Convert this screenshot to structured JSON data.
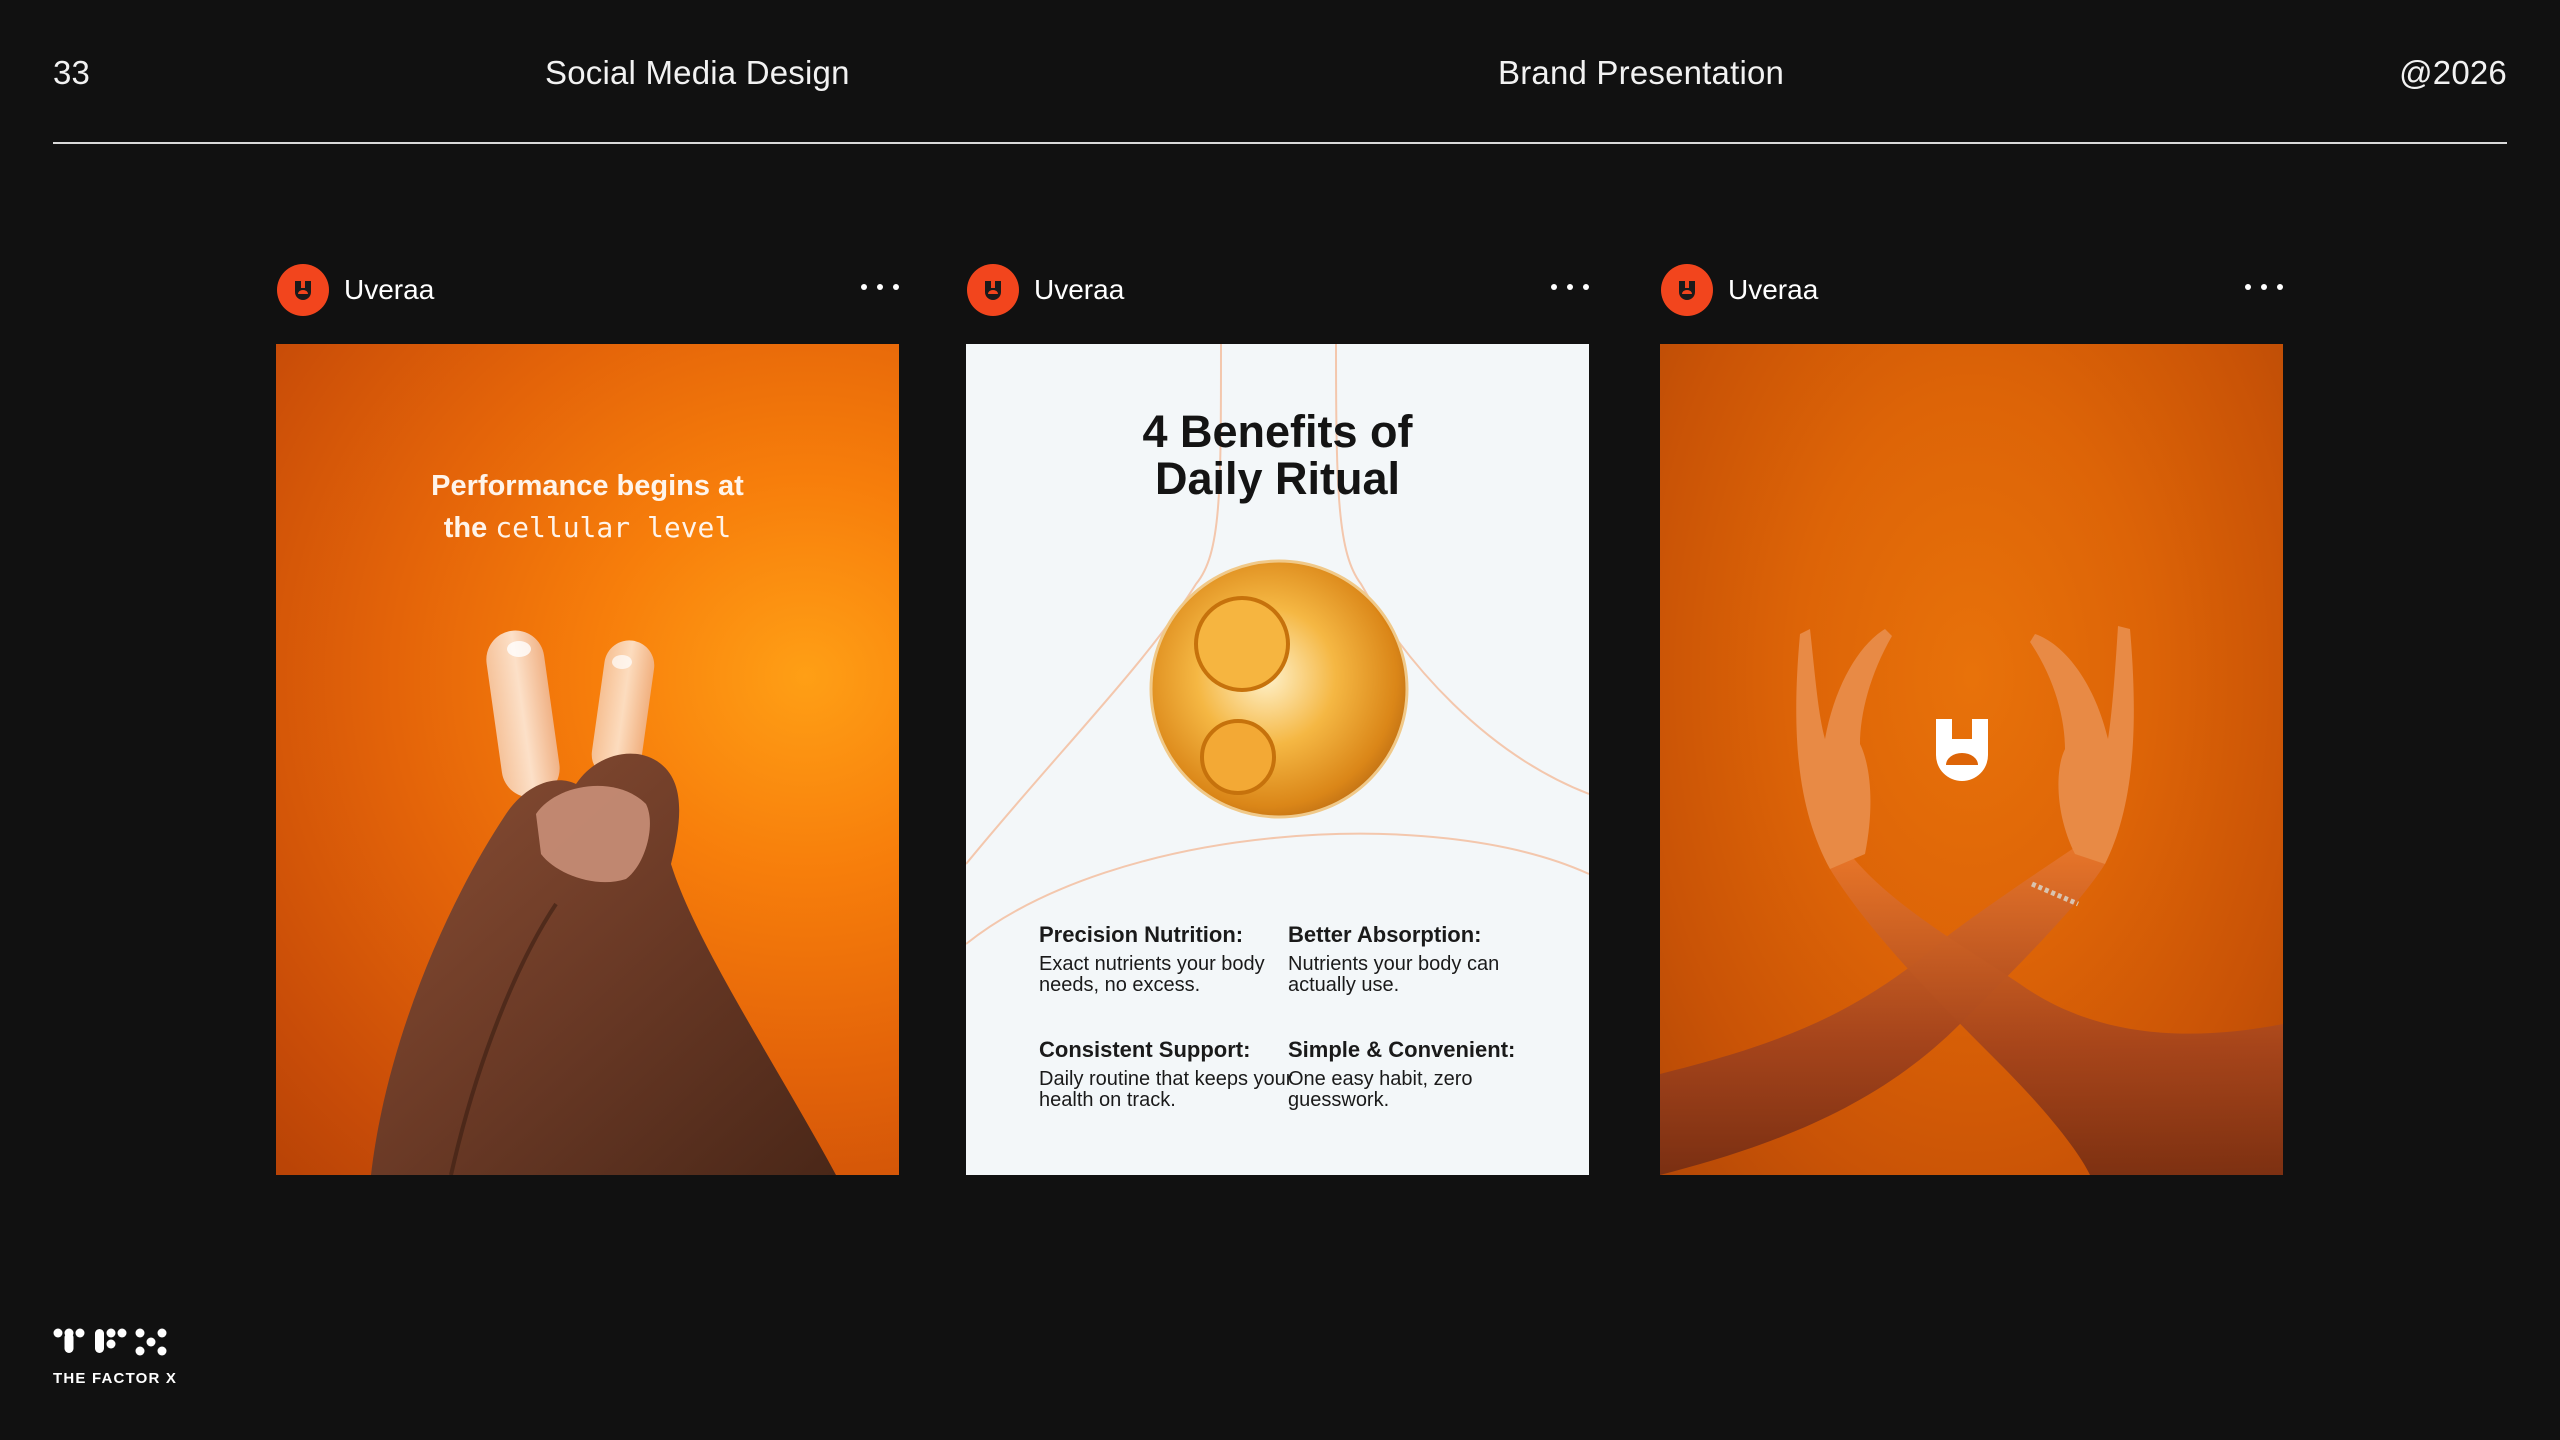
{
  "header": {
    "page_number": "33",
    "left_title": "Social Media Design",
    "center_title": "Brand Presentation",
    "right_label": "@2026"
  },
  "posts": [
    {
      "username": "Uveraa",
      "image": {
        "headline_line1": "Performance begins at",
        "headline_word": "the",
        "headline_mono": "cellular level"
      }
    },
    {
      "username": "Uveraa",
      "image": {
        "title_line1": "4 Benefits of",
        "title_line2": "Daily Ritual",
        "benefits": [
          {
            "title": "Precision Nutrition:",
            "text": "Exact nutrients your body needs, no excess."
          },
          {
            "title": "Better Absorption:",
            "text": "Nutrients your body can actually use."
          },
          {
            "title": "Consistent Support:",
            "text": "Daily routine that keeps your health on track."
          },
          {
            "title": "Simple & Convenient:",
            "text": "One easy habit, zero guesswork."
          }
        ]
      }
    },
    {
      "username": "Uveraa"
    }
  ],
  "footer": {
    "logo_text": "THE FACTOR X"
  },
  "colors": {
    "background": "#111111",
    "accent": "#f2451d",
    "orange": "#f77e0b",
    "card_light": "#f3f7f9"
  },
  "icons": {
    "avatar": "brand-shield-icon",
    "menu": "more-horizontal-icon"
  }
}
